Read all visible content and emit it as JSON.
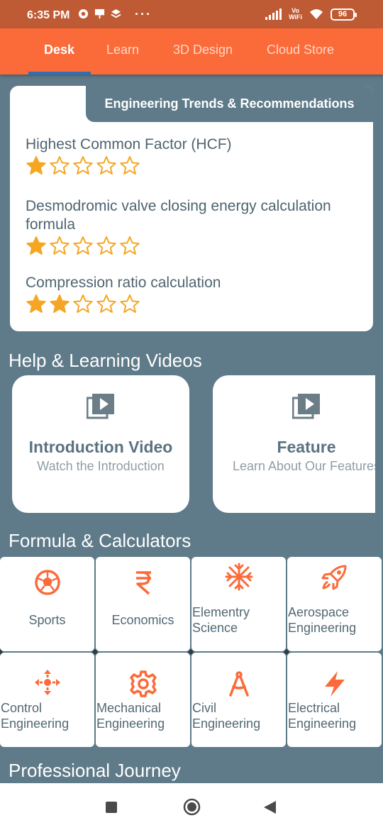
{
  "status_bar": {
    "time": "6:35 PM",
    "vowifi_top": "Vo",
    "vowifi_bottom": "WiFi",
    "battery": "96",
    "more": "···"
  },
  "tabs": [
    {
      "label": "Desk",
      "active": true
    },
    {
      "label": "Learn",
      "active": false
    },
    {
      "label": "3D Design",
      "active": false
    },
    {
      "label": "Cloud Store",
      "active": false
    }
  ],
  "trends": {
    "header": "Engineering Trends & Recommendations",
    "items": [
      {
        "title": "Highest Common Factor (HCF)",
        "rating": 1,
        "max": 5
      },
      {
        "title": "Desmodromic valve closing energy calculation formula",
        "rating": 1,
        "max": 5
      },
      {
        "title": "Compression ratio calculation",
        "rating": 2,
        "max": 5
      }
    ]
  },
  "videos": {
    "heading": "Help & Learning Videos",
    "items": [
      {
        "title": "Introduction Video",
        "subtitle": "Watch the Introduction",
        "icon": "video-library-icon"
      },
      {
        "title": "Feature",
        "subtitle": "Learn About Our Features",
        "icon": "video-library-icon"
      }
    ]
  },
  "calculators": {
    "heading": "Formula & Calculators",
    "items": [
      {
        "label": "Sports",
        "icon": "soccer-ball-icon"
      },
      {
        "label": "Economics",
        "icon": "rupee-icon"
      },
      {
        "label": "Elementry Science",
        "icon": "snowflake-icon"
      },
      {
        "label": "Aerospace Engineering",
        "icon": "rocket-icon"
      },
      {
        "label": "Control Engineering",
        "icon": "control-arrows-icon"
      },
      {
        "label": "Mechanical Engineering",
        "icon": "gear-icon"
      },
      {
        "label": "Civil Engineering",
        "icon": "compass-icon"
      },
      {
        "label": "Electrical Engineering",
        "icon": "lightning-icon"
      }
    ]
  },
  "professional": {
    "heading": "Professional Journey"
  },
  "colors": {
    "accent": "#fb6b3a",
    "background": "#5f7a89",
    "star": "#f5a623",
    "icon": "#fb6b3a"
  }
}
